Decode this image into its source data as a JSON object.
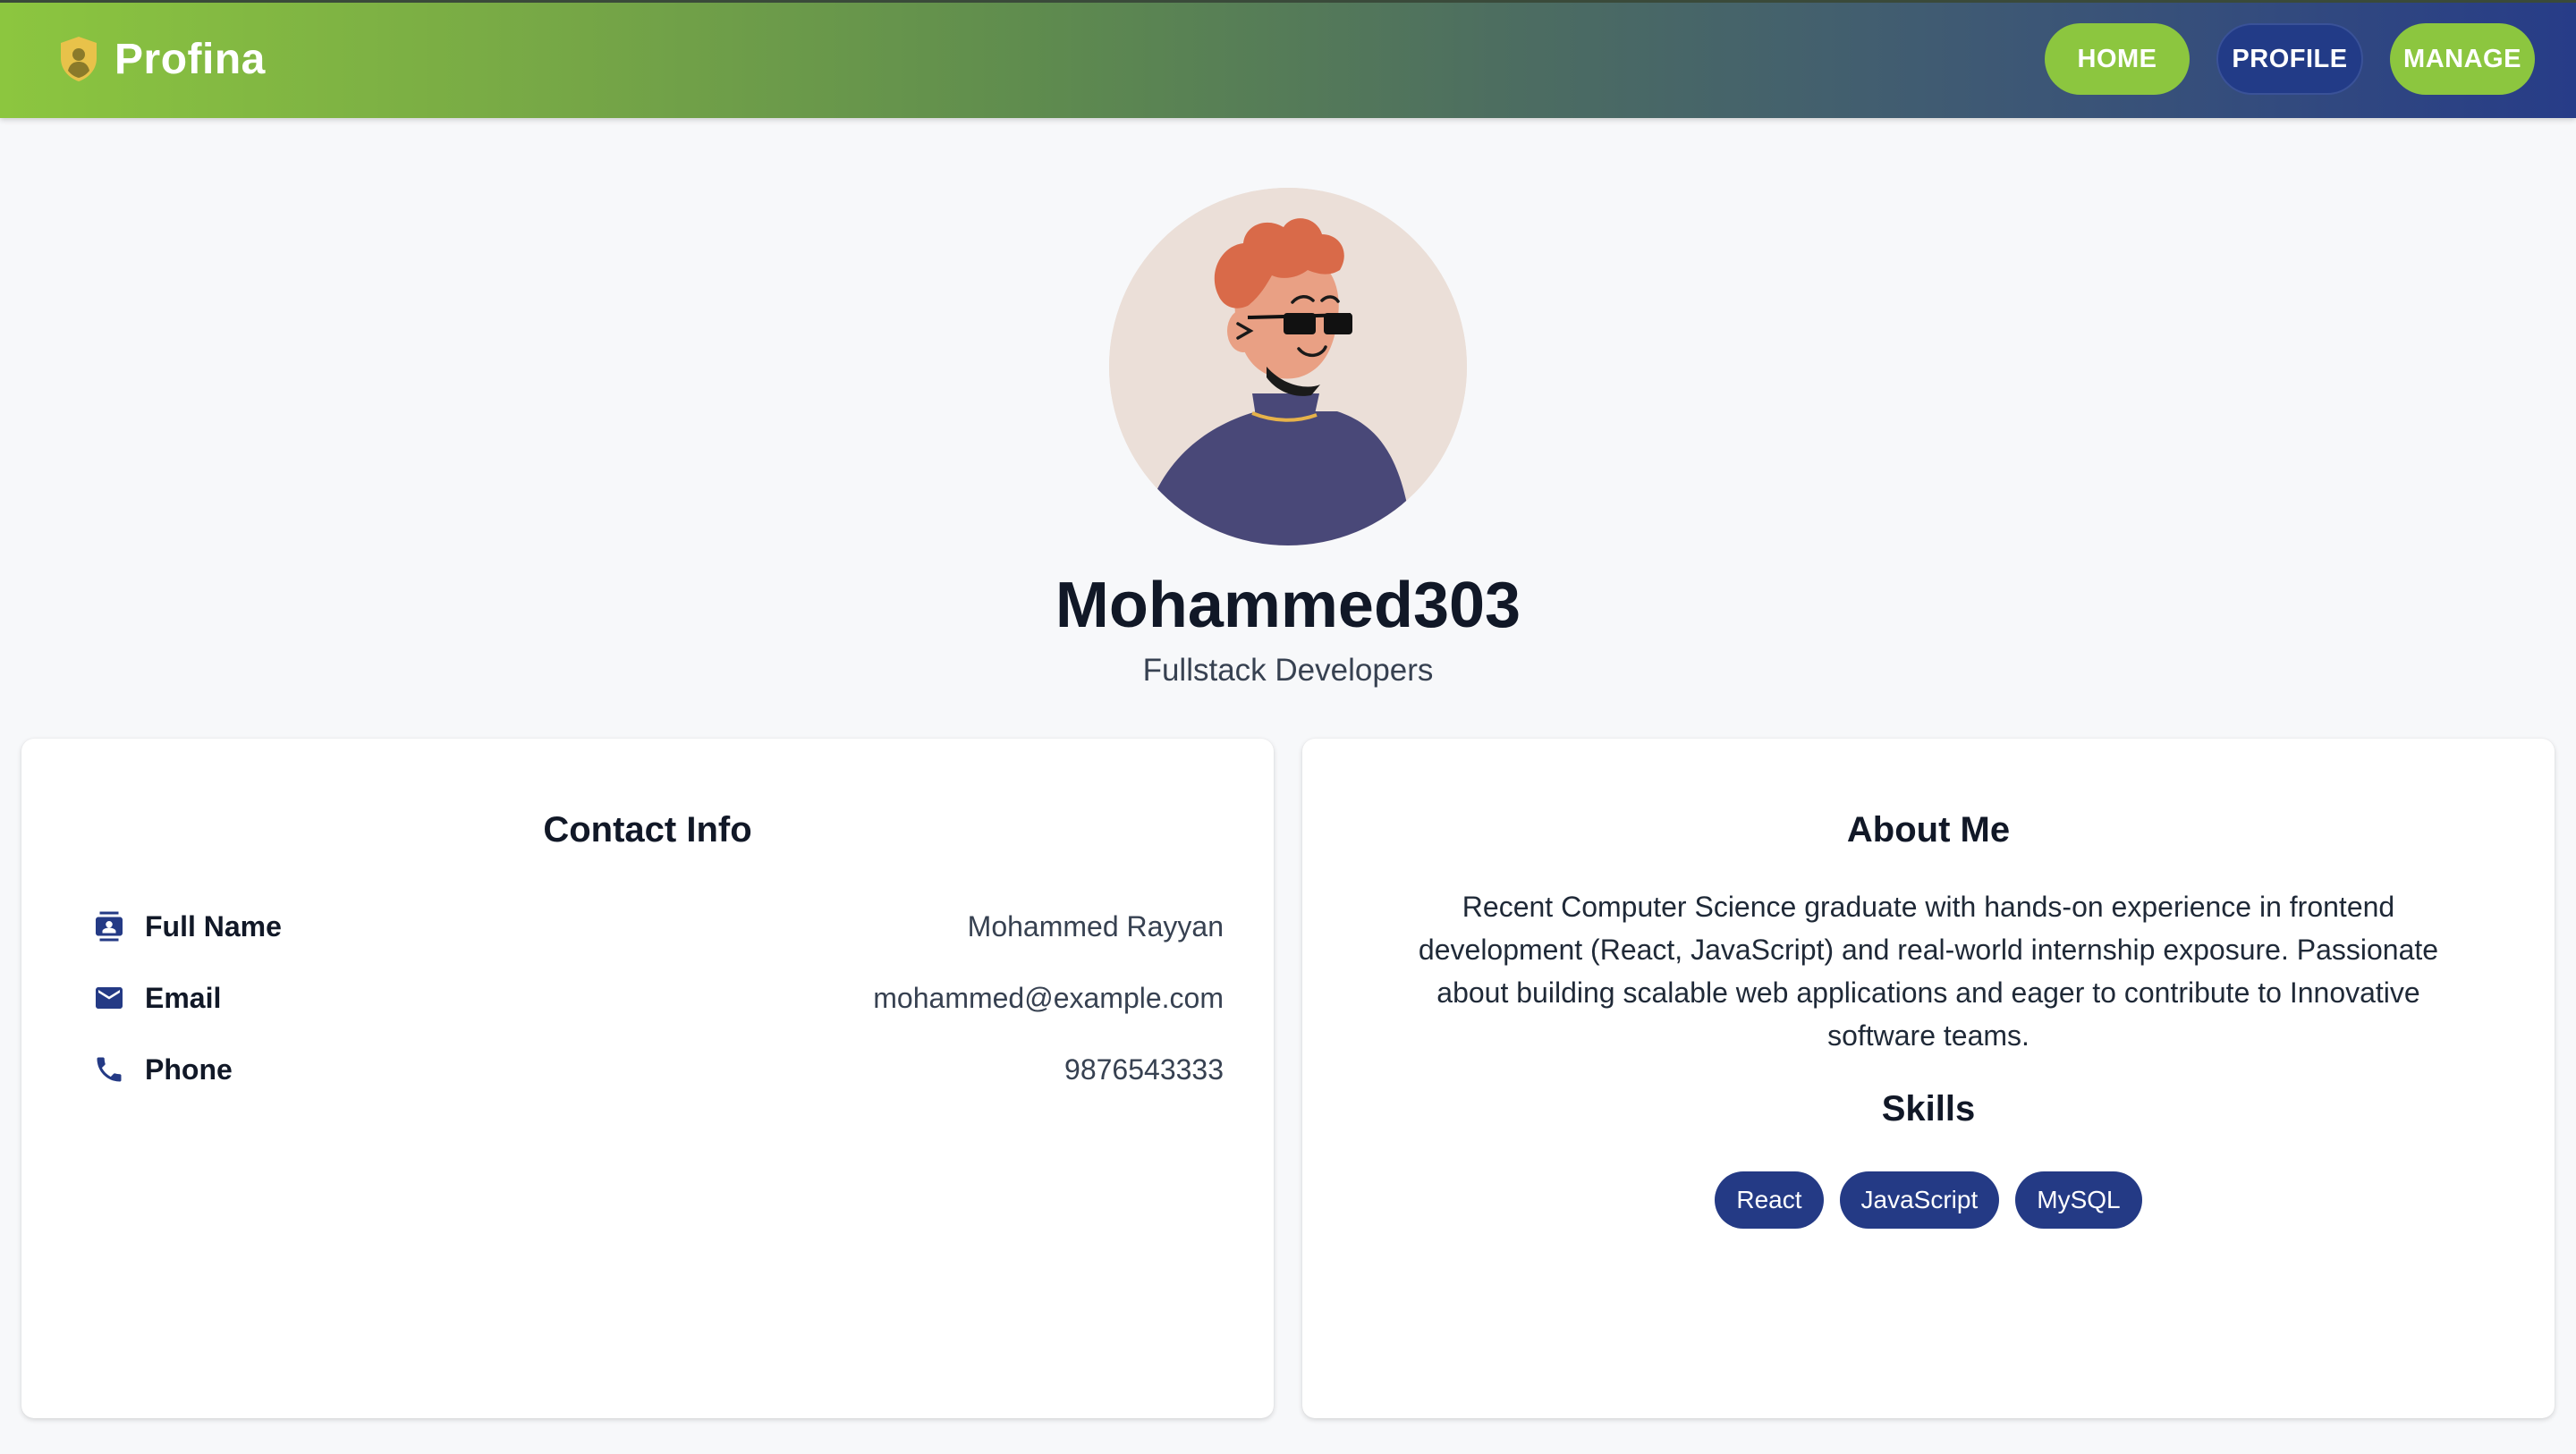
{
  "nav": {
    "brand": "Profina",
    "brand_icon": "shield-user-icon",
    "links": [
      "HOME",
      "PROFILE",
      "MANAGE"
    ],
    "active": "PROFILE"
  },
  "profile": {
    "username": "Mohammed303",
    "role": "Fullstack Developers",
    "avatar_icon": "avatar-illustration"
  },
  "contact": {
    "title": "Contact Info",
    "rows": [
      {
        "label": "Full Name",
        "value": "Mohammed Rayyan",
        "icon": "contact-card-icon"
      },
      {
        "label": "Email",
        "value": "mohammed@example.com",
        "icon": "mail-icon"
      },
      {
        "label": "Phone",
        "value": "9876543333",
        "icon": "phone-icon"
      }
    ]
  },
  "about": {
    "title": "About Me",
    "text": "Recent Computer Science graduate with hands-on experience in frontend development (React, JavaScript) and real-world internship exposure. Passionate about building scalable web applications and eager to contribute to Innovative software teams.",
    "skills_title": "Skills",
    "skills": [
      "React",
      "JavaScript",
      "MySQL"
    ]
  },
  "colors": {
    "accent_green": "#8cc63f",
    "accent_navy": "#243a85",
    "page_bg": "#f7f8fa"
  }
}
